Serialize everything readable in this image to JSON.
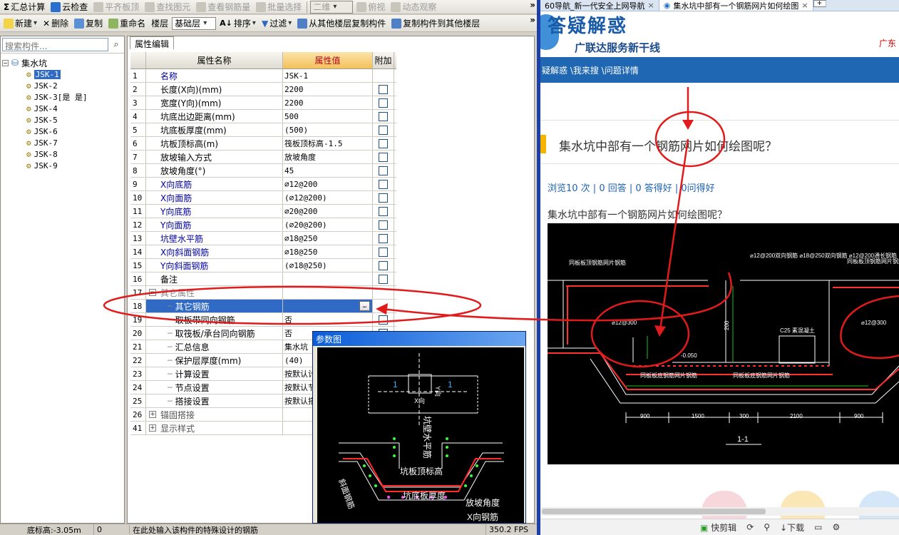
{
  "toolbar1": {
    "items": [
      {
        "label": "汇总计算",
        "icon": "sigma-icon",
        "enabled": true
      },
      {
        "label": "云检查",
        "icon": "cloud-check-icon",
        "enabled": true
      },
      {
        "label": "平齐板顶",
        "icon": "align-icon",
        "enabled": false
      },
      {
        "label": "查找图元",
        "icon": "find-icon",
        "enabled": false
      },
      {
        "label": "查看钢筋量",
        "icon": "rebar-qty-icon",
        "enabled": false
      },
      {
        "label": "批量选择",
        "icon": "batch-select-icon",
        "enabled": false
      }
    ],
    "view_combo": "二维",
    "view_items": [
      {
        "label": "俯视",
        "enabled": false
      },
      {
        "label": "动态观察",
        "enabled": false
      }
    ],
    "more": "»"
  },
  "toolbar2": {
    "new": "新建",
    "delete": "删除",
    "copy": "复制",
    "rename": "重命名",
    "floor_label": "楼层",
    "floor_value": "基础层",
    "sort": "排序",
    "filter": "过滤",
    "copy_from": "从其他楼层复制构件",
    "copy_to": "复制构件到其他楼层",
    "more": "»"
  },
  "tree": {
    "search_placeholder": "搜索构件...",
    "root": "集水坑",
    "items": [
      "JSK-1",
      "JSK-2",
      "JSK-3[是 是]",
      "JSK-4",
      "JSK-5",
      "JSK-6",
      "JSK-7",
      "JSK-8",
      "JSK-9"
    ],
    "selected": "JSK-1"
  },
  "property_panel": {
    "tab": "属性编辑",
    "headers": {
      "num": "",
      "name": "属性名称",
      "value": "属性值",
      "extra": "附加"
    },
    "rows": [
      {
        "num": "1",
        "name": "名称",
        "value": "JSK-1",
        "checkbox": false,
        "style": "blue"
      },
      {
        "num": "2",
        "name": "长度(X向)(mm)",
        "value": "2200",
        "checkbox": true,
        "style": "normal"
      },
      {
        "num": "3",
        "name": "宽度(Y向)(mm)",
        "value": "2200",
        "checkbox": true,
        "style": "normal"
      },
      {
        "num": "4",
        "name": "坑底出边距离(mm)",
        "value": "500",
        "checkbox": true,
        "style": "normal"
      },
      {
        "num": "5",
        "name": "坑底板厚度(mm)",
        "value": "(500)",
        "checkbox": true,
        "style": "normal"
      },
      {
        "num": "6",
        "name": "坑板顶标高(m)",
        "value": "筏板顶标高-1.5",
        "checkbox": true,
        "style": "normal"
      },
      {
        "num": "7",
        "name": "放坡输入方式",
        "value": "放坡角度",
        "checkbox": true,
        "style": "normal"
      },
      {
        "num": "8",
        "name": "放坡角度(°)",
        "value": "45",
        "checkbox": true,
        "style": "normal"
      },
      {
        "num": "9",
        "name": "X向底筋",
        "value": "⌀12@200",
        "checkbox": true,
        "style": "blue"
      },
      {
        "num": "10",
        "name": "X向面筋",
        "value": "(⌀12@200)",
        "checkbox": true,
        "style": "blue"
      },
      {
        "num": "11",
        "name": "Y向底筋",
        "value": "⌀20@200",
        "checkbox": true,
        "style": "blue"
      },
      {
        "num": "12",
        "name": "Y向面筋",
        "value": "(⌀20@200)",
        "checkbox": true,
        "style": "blue"
      },
      {
        "num": "13",
        "name": "坑壁水平筋",
        "value": "⌀18@250",
        "checkbox": true,
        "style": "blue"
      },
      {
        "num": "14",
        "name": "X向斜面钢筋",
        "value": "⌀18@250",
        "checkbox": true,
        "style": "blue"
      },
      {
        "num": "15",
        "name": "Y向斜面钢筋",
        "value": "(⌀18@250)",
        "checkbox": true,
        "style": "blue"
      },
      {
        "num": "16",
        "name": "备注",
        "value": "",
        "checkbox": true,
        "style": "normal"
      },
      {
        "num": "17",
        "name": "其它属性",
        "value": "",
        "checkbox": false,
        "style": "group"
      },
      {
        "num": "18",
        "name": "其它钢筋",
        "value": "",
        "checkbox": false,
        "style": "selected"
      },
      {
        "num": "19",
        "name": "取板带同向钢筋",
        "value": "否",
        "checkbox": true,
        "style": "child"
      },
      {
        "num": "20",
        "name": "取筏板/承台同向钢筋",
        "value": "否",
        "checkbox": true,
        "style": "child"
      },
      {
        "num": "21",
        "name": "汇总信息",
        "value": "集水坑",
        "checkbox": false,
        "style": "child"
      },
      {
        "num": "22",
        "name": "保护层厚度(mm)",
        "value": "(40)",
        "checkbox": false,
        "style": "child"
      },
      {
        "num": "23",
        "name": "计算设置",
        "value": "按默认计",
        "checkbox": false,
        "style": "child"
      },
      {
        "num": "24",
        "name": "节点设置",
        "value": "按默认节",
        "checkbox": false,
        "style": "child"
      },
      {
        "num": "25",
        "name": "搭接设置",
        "value": "按默认搭",
        "checkbox": false,
        "style": "child"
      },
      {
        "num": "26",
        "name": "锚固搭接",
        "value": "",
        "checkbox": false,
        "style": "expand"
      },
      {
        "num": "41",
        "name": "显示样式",
        "value": "",
        "checkbox": false,
        "style": "expand"
      }
    ],
    "ellipsis": "…"
  },
  "param_window": {
    "title": "参数图",
    "labels": {
      "one": "1",
      "x_dir": "X向",
      "y_dir": "Y向",
      "wall_horiz": "坑壁水平筋",
      "pit_top": "坑板顶标高",
      "bottom_thick": "坑底板厚度",
      "slope_angle": "放坡角度",
      "x_rebar": "X向钢筋",
      "slope_rebar": "斜面钢筋"
    }
  },
  "status_bar": {
    "elevation": "底标高:-3.05m",
    "value": "0",
    "hint": "在此处输入该构件的特殊设计的钢筋",
    "fps": "350.2 FPS"
  },
  "browser": {
    "tabs": [
      {
        "label": "60导航_新一代安全上网导航",
        "active": false
      },
      {
        "label": "集水坑中部有一个钢筋网片如何绘图",
        "active": true
      }
    ],
    "new_tab": "+",
    "close_symbol": "×",
    "banner_logo": "答疑解惑",
    "banner_slogan": "广联达服务新干线",
    "banner_right": "广东",
    "breadcrumb": "疑解惑 \\我来搜 \\问题详情",
    "question_title": "集水坑中部有一个钢筋网片如何绘图呢？",
    "stats": "浏览10 次 | 0 回答 | 0 答得好 | 0问得好",
    "question_text": "集水坑中部有一个钢筋网片如何绘图呢？",
    "drawing_labels": {
      "left_top": "同板板顶钢筋网片钢筋",
      "right_top": "同板板顶钢筋网片钢筋",
      "center_top": "⌀12@200双向钢筋\n⌀18@250双向钢筋\n⌀12@200通长钢筋",
      "left_circle": "⌀12@300",
      "right_circle": "⌀12@300",
      "elevation": "-0.050",
      "mesh": "C25 素混凝土",
      "bottom_left": "同板板底钢筋网片钢筋",
      "bottom_center": "同板板底钢筋网片钢筋",
      "dims": [
        "900",
        "1500",
        "300",
        "2100",
        "900"
      ],
      "section": "1-1",
      "height_dim": "200"
    },
    "status_items": [
      "快剪辑",
      "下载"
    ],
    "accent_color": "#1f67b3",
    "annotation_color": "#e11b1b"
  }
}
